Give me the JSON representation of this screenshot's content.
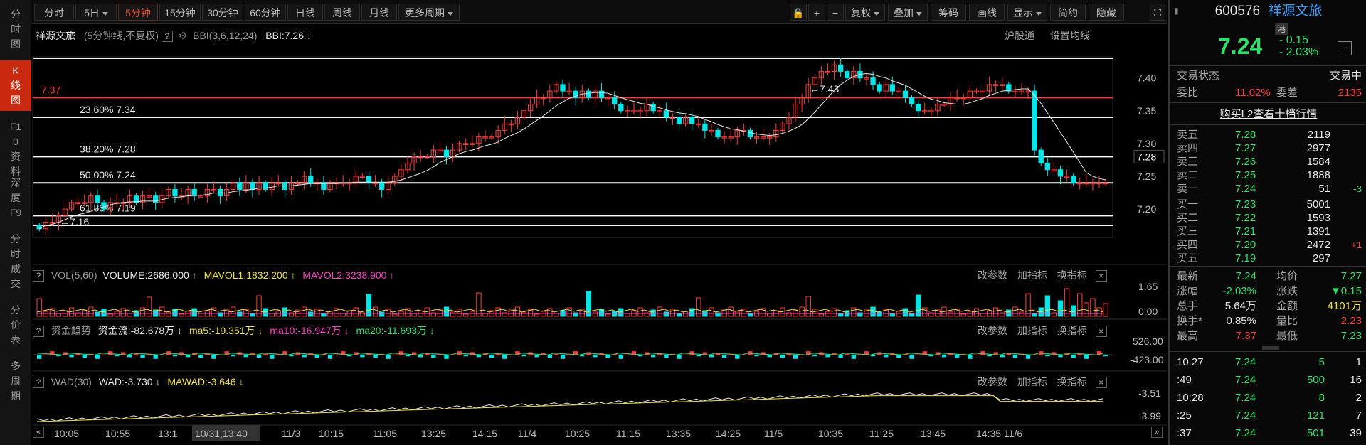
{
  "left_tabs": [
    {
      "label": "分时图",
      "active": false
    },
    {
      "label": "K线图",
      "active": true
    },
    {
      "label": "F10资料",
      "active": false
    },
    {
      "label": "深度F9",
      "active": false
    },
    {
      "label": "分时成交",
      "active": false
    },
    {
      "label": "分价表",
      "active": false
    },
    {
      "label": "多周期",
      "active": false
    }
  ],
  "toolbar": {
    "periods": [
      {
        "label": "分时",
        "dropdown": false,
        "active": false
      },
      {
        "label": "5日",
        "dropdown": true,
        "active": false
      },
      {
        "label": "5分钟",
        "dropdown": false,
        "active": true
      },
      {
        "label": "15分钟",
        "dropdown": false,
        "active": false
      },
      {
        "label": "30分钟",
        "dropdown": false,
        "active": false
      },
      {
        "label": "60分钟",
        "dropdown": false,
        "active": false
      },
      {
        "label": "日线",
        "dropdown": false,
        "active": false
      },
      {
        "label": "周线",
        "dropdown": false,
        "active": false
      },
      {
        "label": "月线",
        "dropdown": false,
        "active": false
      },
      {
        "label": "更多周期",
        "dropdown": true,
        "active": false
      }
    ],
    "tools": [
      {
        "label": "复权",
        "dropdown": true
      },
      {
        "label": "叠加",
        "dropdown": true
      },
      {
        "label": "筹码",
        "dropdown": false
      },
      {
        "label": "画线",
        "dropdown": false
      },
      {
        "label": "显示",
        "dropdown": true
      },
      {
        "label": "简约",
        "dropdown": false
      },
      {
        "label": "隐藏",
        "dropdown": false
      }
    ],
    "icons": [
      "lock-icon",
      "zoom-in-icon",
      "zoom-out-icon",
      "fullscreen-icon"
    ]
  },
  "main": {
    "stock_name": "祥源文旅",
    "period_note": "(5分钟线,不复权)",
    "indicator": "BBI(3,6,12,24)",
    "indicator_value": "BBI:7.26 ↓",
    "right_links": [
      "沪股通",
      "设置均线"
    ],
    "price_axis": [
      "7.40",
      "7.35",
      "7.30",
      "7.25",
      "7.20"
    ],
    "current_price_tag": "7.28",
    "high_label": "←7.43",
    "low_label": "←7.16",
    "red_line_label": "7.37",
    "fib_labels": [
      "23.60% 7.34",
      "38.20% 7.28",
      "50.00% 7.24",
      "61.80% 7.19"
    ]
  },
  "vol_pane": {
    "title": "VOL(5,60)",
    "volume": "VOLUME:2686.000",
    "mavol1": "MAVOL1:1832.200",
    "mavol2": "MAVOL2:3238.900",
    "axis": [
      "1.65",
      "0.00"
    ]
  },
  "fund_pane": {
    "title": "资金趋势",
    "flow": "资金流:-82.678万",
    "ma5": "ma5:-19.351万",
    "ma10": "ma10:-16.947万",
    "ma20": "ma20:-11.693万",
    "axis": [
      "526.00",
      "-423.00"
    ]
  },
  "wad_pane": {
    "title": "WAD(30)",
    "wad": "WAD:-3.730",
    "mawad": "MAWAD:-3.646",
    "axis": [
      "-3.51",
      "-3.99"
    ]
  },
  "pane_links": [
    "改参数",
    "加指标",
    "换指标"
  ],
  "time_axis": [
    "10:05",
    "10:55",
    "13:1",
    "10/31,13:40",
    "11/3",
    "10:15",
    "11:05",
    "13:25",
    "14:15",
    "11/4",
    "10:25",
    "11:15",
    "13:35",
    "14:25",
    "11/5",
    "10:35",
    "11:25",
    "13:45",
    "14:35 11/6"
  ],
  "quote": {
    "code": "600576",
    "name": "祥源文旅",
    "badge": "港",
    "price": "7.24",
    "change": "- 0.15",
    "change_pct": "- 2.03%",
    "status_label": "交易状态",
    "status_value": "交易中",
    "weibi_label": "委比",
    "weibi": "11.02%",
    "weicha_label": "委差",
    "weicha": "2135",
    "l2_link": "购买L2查看十档行情",
    "asks": [
      {
        "label": "卖五",
        "price": "7.28",
        "vol": "2119",
        "chg": ""
      },
      {
        "label": "卖四",
        "price": "7.27",
        "vol": "2977",
        "chg": ""
      },
      {
        "label": "卖三",
        "price": "7.26",
        "vol": "1584",
        "chg": ""
      },
      {
        "label": "卖二",
        "price": "7.25",
        "vol": "1888",
        "chg": ""
      },
      {
        "label": "卖一",
        "price": "7.24",
        "vol": "51",
        "chg": "-3"
      }
    ],
    "bids": [
      {
        "label": "买一",
        "price": "7.23",
        "vol": "5001",
        "chg": ""
      },
      {
        "label": "买二",
        "price": "7.22",
        "vol": "1593",
        "chg": ""
      },
      {
        "label": "买三",
        "price": "7.21",
        "vol": "1391",
        "chg": ""
      },
      {
        "label": "买四",
        "price": "7.20",
        "vol": "2472",
        "chg": "+1"
      },
      {
        "label": "买五",
        "price": "7.19",
        "vol": "297",
        "chg": ""
      }
    ],
    "stats": [
      {
        "l1": "最新",
        "v1": "7.24",
        "c1": "green",
        "l2": "均价",
        "v2": "7.27",
        "c2": "green"
      },
      {
        "l1": "涨幅",
        "v1": "-2.03%",
        "c1": "green",
        "l2": "涨跌",
        "v2": "▼0.15",
        "c2": "green"
      },
      {
        "l1": "总手",
        "v1": "5.64万",
        "c1": "white",
        "l2": "金额",
        "v2": "4101万",
        "c2": "yellow"
      },
      {
        "l1": "换手*",
        "v1": "0.85%",
        "c1": "white",
        "l2": "量比",
        "v2": "2.23",
        "c2": "red"
      },
      {
        "l1": "最高",
        "v1": "7.37",
        "c1": "red",
        "l2": "最低",
        "v2": "7.23",
        "c2": "green"
      }
    ],
    "ticks": [
      {
        "time": "10:27",
        "price": "7.24",
        "vol": "5",
        "n": "1"
      },
      {
        "time": ":49",
        "price": "7.24",
        "vol": "500",
        "n": "16"
      },
      {
        "time": "10:28",
        "price": "7.24",
        "vol": "8",
        "n": "2"
      },
      {
        "time": ":25",
        "price": "7.24",
        "vol": "121",
        "n": "7"
      },
      {
        "time": ":37",
        "price": "7.24",
        "vol": "501",
        "n": "39"
      }
    ]
  },
  "colors": {
    "up": "#ff3b3b",
    "down": "#00e5e5",
    "accent": "#c9290f",
    "fib": "#ffffff",
    "ma_yellow": "#f0e040",
    "ma_pink": "#ff40c8",
    "ma_green": "#2ee06a"
  },
  "chart_data": {
    "type": "candlestick",
    "price_range": [
      7.16,
      7.43
    ],
    "fib_levels": [
      {
        "pct": "23.60%",
        "price": 7.34
      },
      {
        "pct": "38.20%",
        "price": 7.28
      },
      {
        "pct": "50.00%",
        "price": 7.24
      },
      {
        "pct": "61.80%",
        "price": 7.19
      }
    ],
    "reference_line": 7.37,
    "close_series": [
      7.17,
      7.18,
      7.18,
      7.19,
      7.2,
      7.21,
      7.21,
      7.21,
      7.22,
      7.21,
      7.2,
      7.21,
      7.21,
      7.21,
      7.22,
      7.21,
      7.22,
      7.22,
      7.21,
      7.22,
      7.23,
      7.22,
      7.22,
      7.23,
      7.22,
      7.22,
      7.23,
      7.23,
      7.22,
      7.23,
      7.24,
      7.23,
      7.24,
      7.23,
      7.24,
      7.23,
      7.24,
      7.24,
      7.23,
      7.24,
      7.24,
      7.25,
      7.24,
      7.24,
      7.23,
      7.24,
      7.24,
      7.24,
      7.24,
      7.25,
      7.25,
      7.24,
      7.24,
      7.23,
      7.24,
      7.25,
      7.26,
      7.27,
      7.28,
      7.28,
      7.28,
      7.29,
      7.29,
      7.28,
      7.29,
      7.3,
      7.3,
      7.3,
      7.31,
      7.31,
      7.31,
      7.32,
      7.33,
      7.33,
      7.34,
      7.35,
      7.36,
      7.37,
      7.37,
      7.38,
      7.39,
      7.38,
      7.38,
      7.37,
      7.38,
      7.37,
      7.38,
      7.37,
      7.37,
      7.36,
      7.35,
      7.35,
      7.35,
      7.35,
      7.36,
      7.35,
      7.35,
      7.34,
      7.34,
      7.33,
      7.34,
      7.33,
      7.33,
      7.32,
      7.32,
      7.31,
      7.31,
      7.31,
      7.32,
      7.32,
      7.31,
      7.31,
      7.31,
      7.31,
      7.32,
      7.33,
      7.34,
      7.36,
      7.37,
      7.39,
      7.4,
      7.41,
      7.41,
      7.42,
      7.41,
      7.4,
      7.41,
      7.4,
      7.4,
      7.39,
      7.38,
      7.39,
      7.38,
      7.38,
      7.37,
      7.36,
      7.35,
      7.35,
      7.35,
      7.36,
      7.36,
      7.37,
      7.37,
      7.37,
      7.38,
      7.38,
      7.38,
      7.39,
      7.39,
      7.39,
      7.38,
      7.38,
      7.38,
      7.38,
      7.29,
      7.27,
      7.26,
      7.26,
      7.25,
      7.25,
      7.24,
      7.24,
      7.24,
      7.24,
      7.24,
      7.24
    ],
    "volume_max": 1.65
  }
}
